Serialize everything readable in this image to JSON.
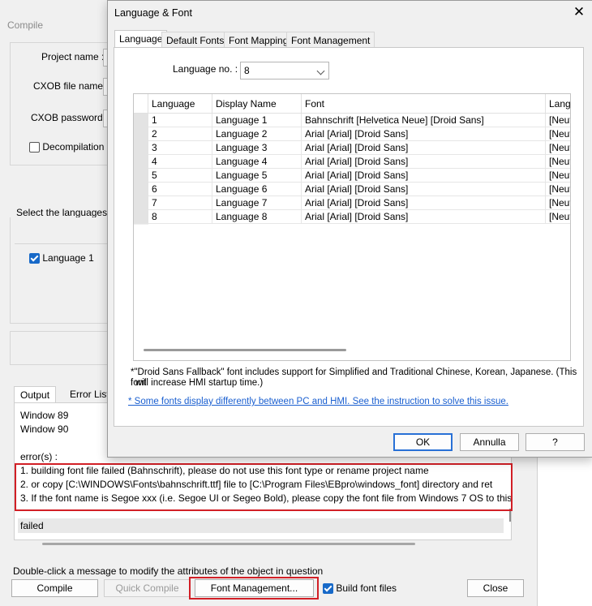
{
  "compile_window": {
    "title": "Compile",
    "project_name_label": "Project name :",
    "cxob_file_label": "CXOB file name :",
    "cxob_password_label": "CXOB password :",
    "decompilation_label": "Decompilation is p",
    "languages_group_label": "Select the languages us",
    "language1_label": "Language 1",
    "tabs": {
      "output": "Output",
      "errors": "Error List"
    },
    "output_lines": {
      "l1": "Window 89",
      "l2": "Window 90",
      "l3": "error(s) :",
      "e1": "1. building font file failed (Bahnschrift), please do not use this font type or rename project name",
      "e2": "2.      or copy [C:\\WINDOWS\\Fonts\\bahnschrift.ttf] file to [C:\\Program Files\\EBpro\\windows_font] directory and ret",
      "e3": "3.      If the font name is Segoe xxx (i.e. Segoe UI or Segeo Bold), please copy the font file from Windows 7 OS to this",
      "failed": "failed"
    },
    "hint": "Double-click a message to modify the attributes of the object in question",
    "buttons": {
      "compile": "Compile",
      "quick_compile": "Quick Compile",
      "font_management": "Font Management...",
      "build_font_files": "Build font files",
      "close": "Close"
    }
  },
  "dialog": {
    "title": "Language & Font",
    "tabs": [
      "Language",
      "Default Fonts",
      "Font Mapping",
      "Font Management"
    ],
    "language_no_label": "Language no. :",
    "language_no_value": "8",
    "columns": [
      "Language",
      "Display Name",
      "Font",
      "Langu"
    ],
    "rows": [
      {
        "lang": "1",
        "name": "Language 1",
        "font": "Bahnschrift [Helvetica Neue] [Droid Sans]",
        "extra": "[Neut"
      },
      {
        "lang": "2",
        "name": "Language 2",
        "font": "Arial [Arial] [Droid Sans]",
        "extra": "[Neut"
      },
      {
        "lang": "3",
        "name": "Language 3",
        "font": "Arial [Arial] [Droid Sans]",
        "extra": "[Neut"
      },
      {
        "lang": "4",
        "name": "Language 4",
        "font": "Arial [Arial] [Droid Sans]",
        "extra": "[Neut"
      },
      {
        "lang": "5",
        "name": "Language 5",
        "font": "Arial [Arial] [Droid Sans]",
        "extra": "[Neut"
      },
      {
        "lang": "6",
        "name": "Language 6",
        "font": "Arial [Arial] [Droid Sans]",
        "extra": "[Neut"
      },
      {
        "lang": "7",
        "name": "Language 7",
        "font": "Arial [Arial] [Droid Sans]",
        "extra": "[Neut"
      },
      {
        "lang": "8",
        "name": "Language 8",
        "font": "Arial [Arial] [Droid Sans]",
        "extra": "[Neut"
      }
    ],
    "note_line1": "*\"Droid Sans Fallback\" font includes support for Simplified and Traditional Chinese, Korean, Japanese. (This font",
    "note_line2": "will increase HMI startup time.)",
    "link": "* Some fonts display differently between PC and HMI. See the instruction to solve this issue.",
    "buttons": {
      "ok": "OK",
      "cancel": "Annulla",
      "help": "?"
    },
    "close_glyph": "✕"
  }
}
